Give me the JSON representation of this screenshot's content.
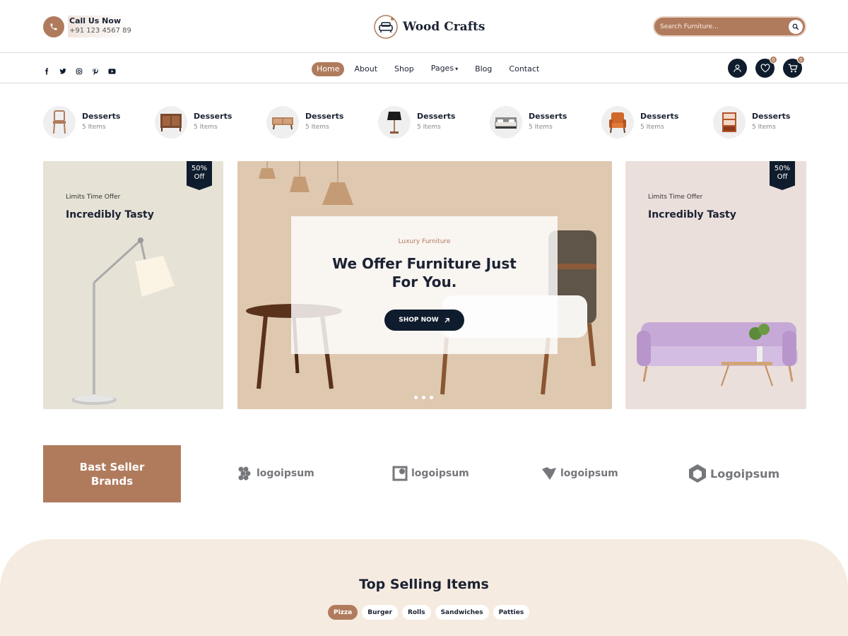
{
  "header": {
    "call_title": "Call Us Now",
    "call_number": "+91 123 4567 89",
    "logo_text": "Wood Crafts",
    "search_placeholder": "Search Furniture..."
  },
  "nav": {
    "social": [
      "facebook-icon",
      "twitter-icon",
      "instagram-icon",
      "pinterest-icon",
      "youtube-icon"
    ],
    "items": [
      {
        "label": "Home",
        "active": true
      },
      {
        "label": "About"
      },
      {
        "label": "Shop"
      },
      {
        "label": "Pages",
        "dropdown": true
      },
      {
        "label": "Blog"
      },
      {
        "label": "Contact"
      }
    ],
    "wishlist_count": "0",
    "cart_count": "0"
  },
  "categories": [
    {
      "title": "Desserts",
      "count": "5 Items",
      "icon": "chair-icon"
    },
    {
      "title": "Desserts",
      "count": "5 Items",
      "icon": "cabinet-icon"
    },
    {
      "title": "Desserts",
      "count": "5 Items",
      "icon": "tv-stand-icon"
    },
    {
      "title": "Desserts",
      "count": "5 Items",
      "icon": "lamp-icon"
    },
    {
      "title": "Desserts",
      "count": "5 Items",
      "icon": "bed-icon"
    },
    {
      "title": "Desserts",
      "count": "5 Items",
      "icon": "armchair-icon"
    },
    {
      "title": "Desserts",
      "count": "5 Items",
      "icon": "bookshelf-icon"
    }
  ],
  "promos": {
    "left": {
      "subtitle": "Limits Time Offer",
      "title": "Incredibly Tasty",
      "badge_line1": "50%",
      "badge_line2": "Off"
    },
    "right": {
      "subtitle": "Limits Time Offer",
      "title": "Incredibly Tasty",
      "badge_line1": "50%",
      "badge_line2": "Off"
    }
  },
  "hero": {
    "subtitle": "Luxury Furniture",
    "title": "We Offer Furniture Just For You.",
    "button": "SHOP NOW"
  },
  "brands": {
    "title": "Bast Seller Brands",
    "logos": [
      "logoipsum",
      "logoipsum",
      "logoipsum",
      "Logoipsum"
    ]
  },
  "top_selling": {
    "title": "Top Selling Items",
    "tabs": [
      {
        "label": "Pizza",
        "active": true
      },
      {
        "label": "Burger"
      },
      {
        "label": "Rolls"
      },
      {
        "label": "Sandwiches"
      },
      {
        "label": "Patties"
      }
    ]
  },
  "colors": {
    "accent": "#b07b5d",
    "dark": "#0f1c2d",
    "cream": "#f6ebe0"
  }
}
